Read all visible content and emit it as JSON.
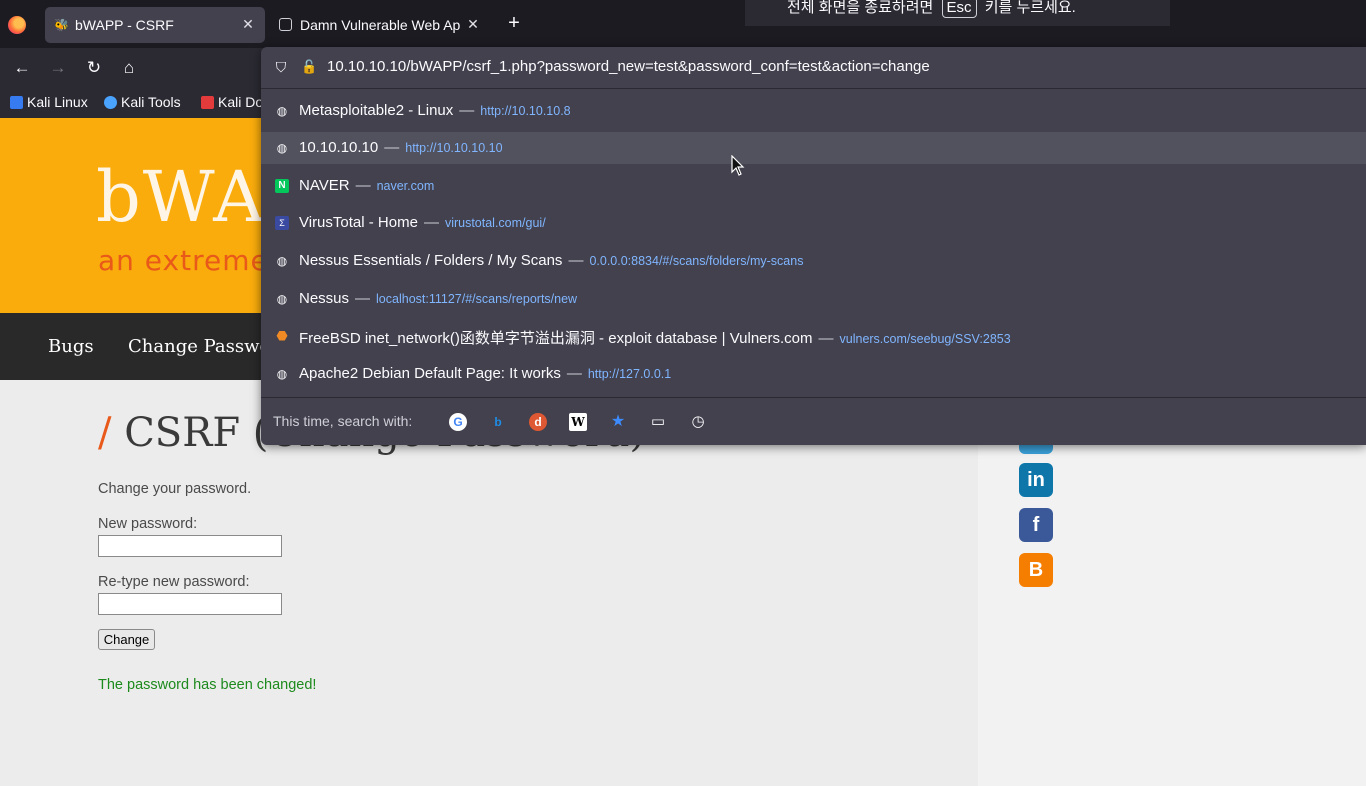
{
  "browser": {
    "tabs": [
      {
        "title": "bWAPP - CSRF",
        "active": true
      },
      {
        "title": "Damn Vulnerable Web Ap",
        "active": false
      }
    ],
    "fullscreen_notice": "전체 화면을 종료하려면",
    "fullscreen_key": "Esc",
    "fullscreen_notice_end": "키를 누르세요.",
    "bookmarks": [
      "Kali Linux",
      "Kali Tools",
      "Kali Do"
    ]
  },
  "urlbar": {
    "url": "10.10.10.10/bWAPP/csrf_1.php?password_new=test&password_conf=test&action=change"
  },
  "suggestions": [
    {
      "title": "Metasploitable2 - Linux",
      "url": "http://10.10.10.8",
      "icon": "globe-icon"
    },
    {
      "title": "10.10.10.10",
      "url": "http://10.10.10.10",
      "icon": "globe-icon",
      "selected": true
    },
    {
      "title": "NAVER",
      "url": "naver.com",
      "icon": "naver-icon"
    },
    {
      "title": "VirusTotal - Home",
      "url": "virustotal.com/gui/",
      "icon": "virustotal-icon"
    },
    {
      "title": "Nessus Essentials / Folders / My Scans",
      "url": "0.0.0.0:8834/#/scans/folders/my-scans",
      "icon": "globe-icon"
    },
    {
      "title": "Nessus",
      "url": "localhost:11127/#/scans/reports/new",
      "icon": "globe-icon"
    },
    {
      "title": "FreeBSD inet_network()函数单字节溢出漏洞 - exploit database | Vulners.com",
      "url": "vulners.com/seebug/SSV:2853",
      "icon": "vulners-icon"
    },
    {
      "title": "Apache2 Debian Default Page: It works",
      "url": "http://127.0.0.1",
      "icon": "globe-icon"
    }
  ],
  "search_footer": {
    "label": "This time, search with:",
    "engines": [
      "google-icon",
      "bing-icon",
      "duckduckgo-icon",
      "wikipedia-icon",
      "bookmarks-icon",
      "tabs-icon",
      "history-icon"
    ]
  },
  "page": {
    "logo": "bWAPP",
    "tagline": "an extremely buggy web app !",
    "menu": [
      "Bugs",
      "Change Password"
    ],
    "title": "CSRF (Change Password)",
    "intro": "Change your password.",
    "new_password_label": "New password:",
    "retype_label": "Re-type new password:",
    "change_button": "Change",
    "success_message": "The password has been changed!"
  },
  "colors": {
    "header_bg": "#f9ac0c",
    "menu_bg": "#292929",
    "accent_orange": "#e8591a",
    "success_green": "#1c8a1c",
    "dropdown_bg": "#42414d",
    "url_link": "#80b5ff"
  }
}
